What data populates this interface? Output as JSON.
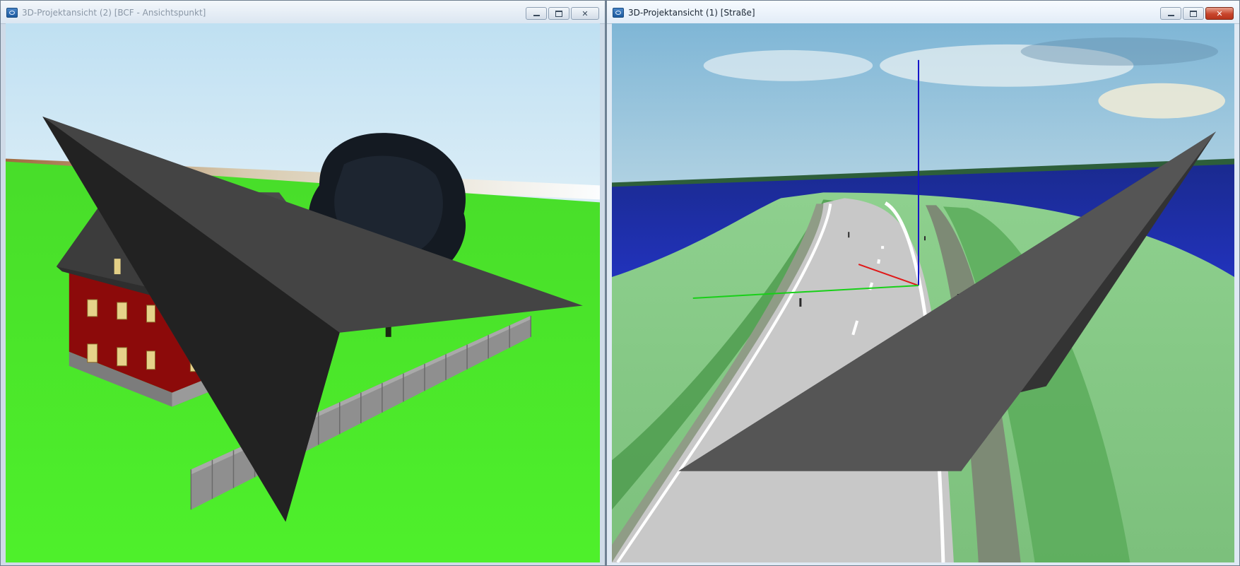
{
  "windows": [
    {
      "id": "left",
      "title": "3D-Projektansicht (2) [BCF - Ansichtspunkt]",
      "active": false,
      "controls": [
        "minimize",
        "maximize",
        "close"
      ]
    },
    {
      "id": "right",
      "title": "3D-Projektansicht (1) [Straße]",
      "active": true,
      "controls": [
        "minimize",
        "maximize",
        "close"
      ]
    }
  ],
  "icons": {
    "app": "app-window-icon",
    "navigation": "navigation-arrow-icon",
    "minimize": "minimize-icon",
    "maximize": "maximize-icon",
    "close": "close-icon"
  },
  "colors": {
    "grass_left": "#52f22c",
    "house_wall": "#8c0a0a",
    "roof": "#4e4e4e",
    "road": "#c7c7c7",
    "water": "#1f2fa8",
    "axis_x": "#e01818",
    "axis_y": "#18d018",
    "axis_z": "#1414c8",
    "close_button_active": "#c8452c"
  }
}
